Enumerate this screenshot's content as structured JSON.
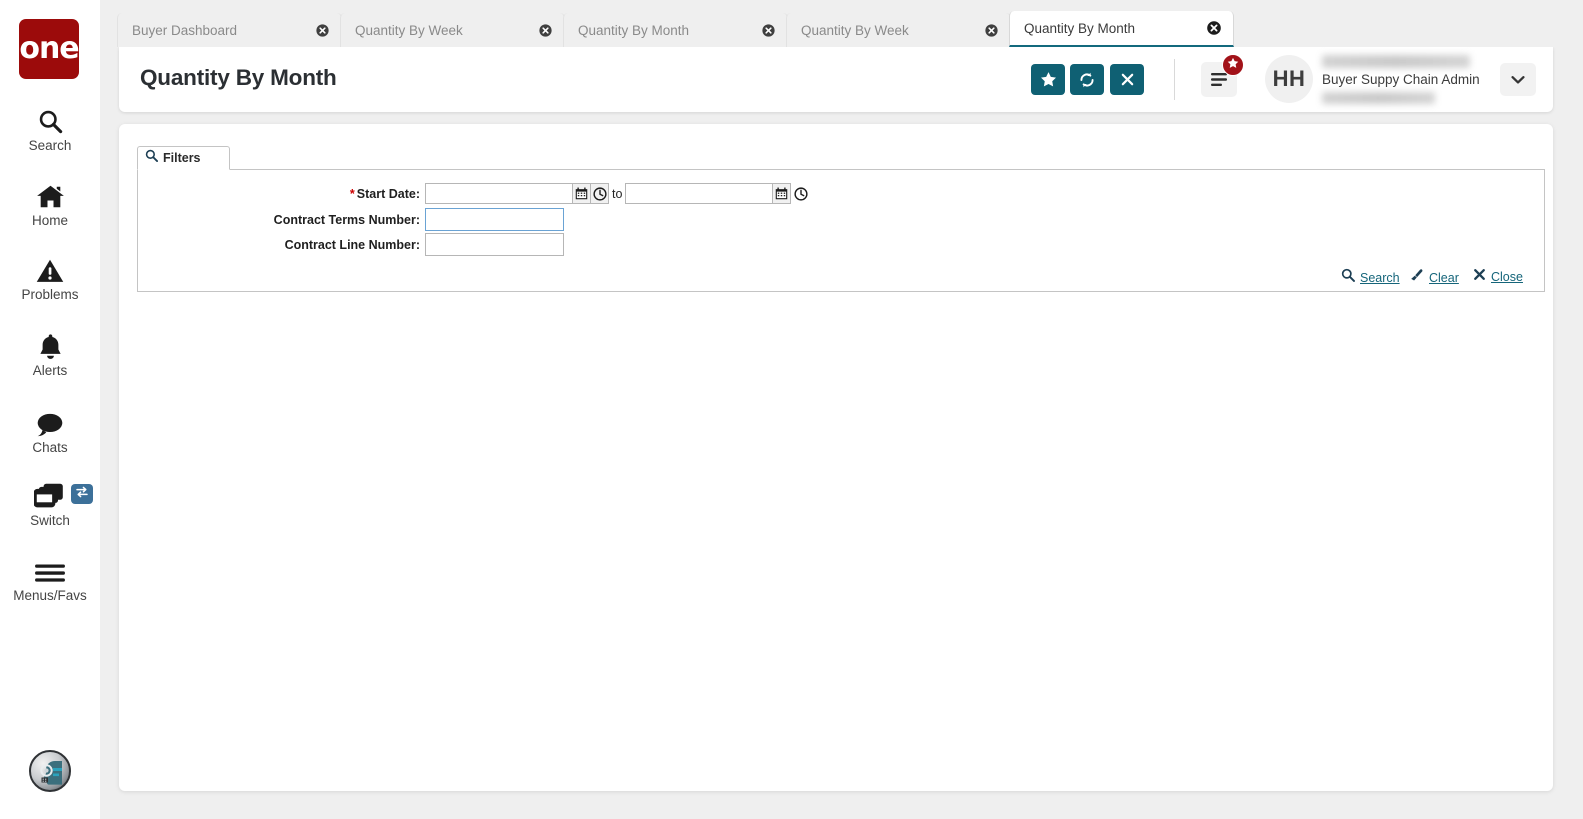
{
  "brand": {
    "logo_text": "one",
    "logo_color": "#9c0b0b",
    "accent_teal": "#0f6073",
    "link_teal": "#15657a",
    "badge_red": "#a21219",
    "switch_badge_blue": "#3c7099"
  },
  "sidebar": {
    "items": [
      {
        "label": "Search",
        "icon": "search-icon"
      },
      {
        "label": "Home",
        "icon": "home-icon"
      },
      {
        "label": "Problems",
        "icon": "warning-triangle-icon"
      },
      {
        "label": "Alerts",
        "icon": "bell-icon"
      },
      {
        "label": "Chats",
        "icon": "chat-bubble-icon"
      },
      {
        "label": "Switch",
        "icon": "switch-windows-icon",
        "badge_icon": "exchange-arrows-icon"
      },
      {
        "label": "Menus/Favs",
        "icon": "hamburger-icon"
      }
    ],
    "bottom_avatar_icon": "ai-assistant-avatar-icon"
  },
  "tabs": [
    {
      "label": "Buyer Dashboard",
      "active": false,
      "close_icon": "close-circle-icon"
    },
    {
      "label": "Quantity By Week",
      "active": false,
      "close_icon": "close-circle-icon"
    },
    {
      "label": "Quantity By Month",
      "active": false,
      "close_icon": "close-circle-icon"
    },
    {
      "label": "Quantity By Week",
      "active": false,
      "close_icon": "close-circle-icon"
    },
    {
      "label": "Quantity By Month",
      "active": true,
      "close_icon": "close-circle-icon"
    }
  ],
  "header": {
    "title": "Quantity By Month",
    "buttons": [
      {
        "name": "favorite-button",
        "icon": "star-icon"
      },
      {
        "name": "refresh-button",
        "icon": "refresh-icon"
      },
      {
        "name": "close-button",
        "icon": "x-icon"
      }
    ],
    "menu_button": {
      "icon": "hamburger-icon",
      "badge_icon": "star-icon"
    },
    "user": {
      "avatar_initials": "HH",
      "name_redacted": true,
      "role": "Buyer Suppy Chain Admin",
      "org_redacted": true,
      "chevron_icon": "chevron-down-icon"
    }
  },
  "filters": {
    "tab_label": "Filters",
    "tab_icon": "search-icon",
    "fields": [
      {
        "label": "Start Date:",
        "required": true,
        "type": "date-range",
        "from_value": "",
        "to_value": "",
        "separator": "to",
        "calendar_icon": "calendar-icon",
        "clock_icon": "clock-icon"
      },
      {
        "label": "Contract Terms Number:",
        "required": false,
        "type": "text",
        "value": "",
        "focused": true
      },
      {
        "label": "Contract Line Number:",
        "required": false,
        "type": "text",
        "value": "",
        "focused": false
      }
    ],
    "actions": [
      {
        "label": "Search",
        "icon": "search-icon"
      },
      {
        "label": "Clear",
        "icon": "eraser-icon"
      },
      {
        "label": "Close",
        "icon": "x-icon"
      }
    ]
  }
}
